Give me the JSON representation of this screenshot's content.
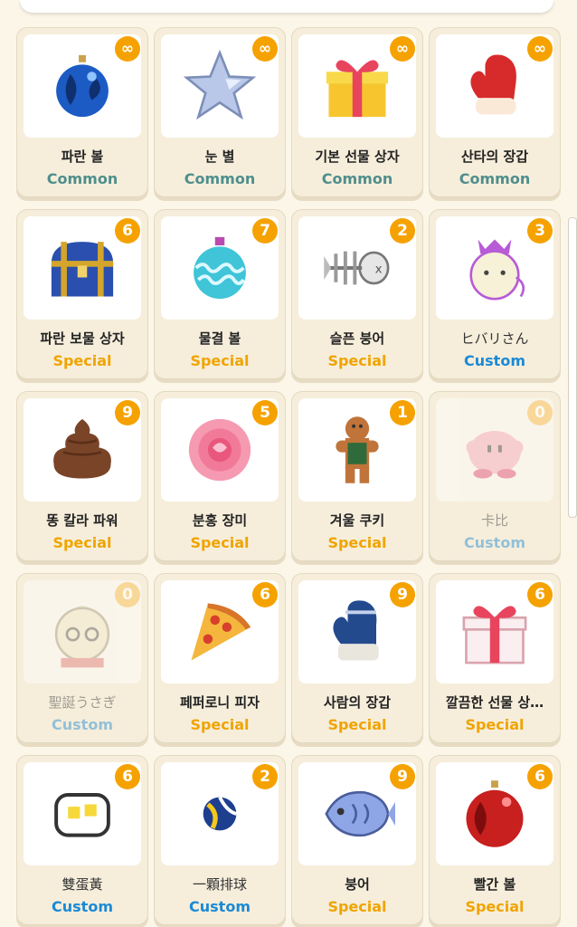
{
  "colors": {
    "background": "#fbf6e8",
    "badge": "#f5a200",
    "common": "#4f8e8c",
    "special": "#f0a400",
    "custom": "#1a8ad6"
  },
  "items": [
    {
      "name": "파란 볼",
      "rarity": "Common",
      "count": "∞",
      "icon": "blue-ornament-icon"
    },
    {
      "name": "눈 별",
      "rarity": "Common",
      "count": "∞",
      "icon": "snow-star-icon"
    },
    {
      "name": "기본 선물 상자",
      "rarity": "Common",
      "count": "∞",
      "icon": "gift-box-icon"
    },
    {
      "name": "산타의 장갑",
      "rarity": "Common",
      "count": "∞",
      "icon": "santa-mitten-icon"
    },
    {
      "name": "파란 보물 상자",
      "rarity": "Special",
      "count": "6",
      "icon": "treasure-chest-icon"
    },
    {
      "name": "물결 볼",
      "rarity": "Special",
      "count": "7",
      "icon": "wave-ornament-icon"
    },
    {
      "name": "슬픈 붕어",
      "rarity": "Special",
      "count": "2",
      "icon": "fish-bone-icon"
    },
    {
      "name": "ヒバリさん",
      "rarity": "Custom",
      "count": "3",
      "icon": "bird-character-icon"
    },
    {
      "name": "똥 칼라 파워",
      "rarity": "Special",
      "count": "9",
      "icon": "poop-icon"
    },
    {
      "name": "분홍 장미",
      "rarity": "Special",
      "count": "5",
      "icon": "pink-rose-icon"
    },
    {
      "name": "겨울 쿠키",
      "rarity": "Special",
      "count": "1",
      "icon": "gingerbread-icon"
    },
    {
      "name": "卡比",
      "rarity": "Custom",
      "count": "0",
      "icon": "kirby-icon"
    },
    {
      "name": "聖誕うさぎ",
      "rarity": "Custom",
      "count": "0",
      "icon": "christmas-rabbit-icon"
    },
    {
      "name": "페퍼로니 피자",
      "rarity": "Special",
      "count": "6",
      "icon": "pizza-icon"
    },
    {
      "name": "사람의 장갑",
      "rarity": "Special",
      "count": "9",
      "icon": "knit-mitten-icon"
    },
    {
      "name": "깔끔한 선물 상…",
      "rarity": "Special",
      "count": "6",
      "icon": "neat-gift-icon"
    },
    {
      "name": "雙蛋黃",
      "rarity": "Custom",
      "count": "6",
      "icon": "double-yolk-icon"
    },
    {
      "name": "一顆排球",
      "rarity": "Custom",
      "count": "2",
      "icon": "volleyball-icon"
    },
    {
      "name": "붕어",
      "rarity": "Special",
      "count": "9",
      "icon": "fish-bread-icon"
    },
    {
      "name": "빨간 볼",
      "rarity": "Special",
      "count": "6",
      "icon": "red-ornament-icon"
    }
  ]
}
